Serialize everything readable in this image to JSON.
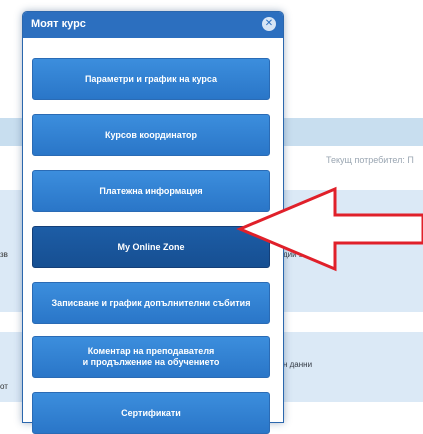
{
  "background": {
    "current_user_label": "Текущ потребител: П",
    "panel1_right_text": "дии за курс",
    "panel1_left_text": "зв",
    "panel2_right_text": "н данни",
    "panel2_left_text": "от"
  },
  "modal": {
    "title": "Моят курс",
    "close_icon": "close-icon",
    "buttons": [
      {
        "label": "Параметри и график на курса"
      },
      {
        "label": "Курсов координатор"
      },
      {
        "label": "Платежна информация"
      },
      {
        "label": "My Online Zone"
      },
      {
        "label": "Записване и график допълнителни събития"
      },
      {
        "label": "Коментар на преподавателя\nи продължение на обучението"
      },
      {
        "label": "Сертификати"
      }
    ]
  },
  "annotation": {
    "arrow_color": "#e0202a",
    "arrow_icon": "red-arrow-icon"
  }
}
